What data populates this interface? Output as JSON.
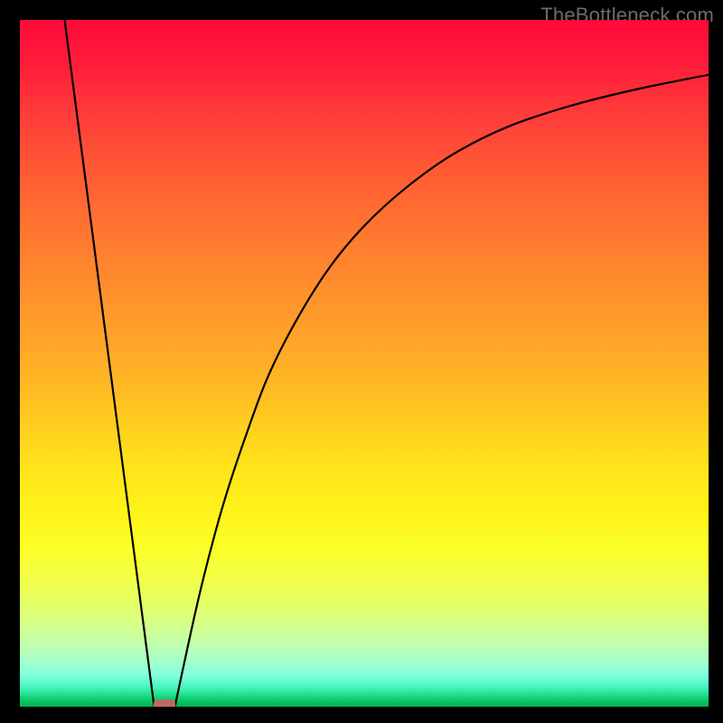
{
  "watermark": "TheBottleneck.com",
  "chart_data": {
    "type": "line",
    "title": "",
    "xlabel": "",
    "ylabel": "",
    "xlim": [
      0,
      100
    ],
    "ylim": [
      0,
      100
    ],
    "grid": false,
    "series": [
      {
        "name": "left-segment",
        "x": [
          6.5,
          19.5
        ],
        "y": [
          100,
          0
        ]
      },
      {
        "name": "right-segment",
        "x": [
          22.5,
          24,
          26,
          28,
          30,
          33,
          36,
          40,
          45,
          50,
          56,
          63,
          71,
          80,
          90,
          100
        ],
        "y": [
          0,
          7,
          16,
          24,
          31,
          40,
          48,
          56,
          64,
          70,
          75.5,
          80.5,
          84.5,
          87.5,
          90,
          92
        ]
      }
    ],
    "marker": {
      "name": "minimum-marker",
      "x": 21,
      "y": 0,
      "width_x": 3.2,
      "color": "#c26864"
    },
    "gradient_stops": [
      {
        "pos": 0,
        "color": "#ff0a3a"
      },
      {
        "pos": 50,
        "color": "#ffb324"
      },
      {
        "pos": 78,
        "color": "#f9ff2e"
      },
      {
        "pos": 100,
        "color": "#02b24d"
      }
    ]
  }
}
